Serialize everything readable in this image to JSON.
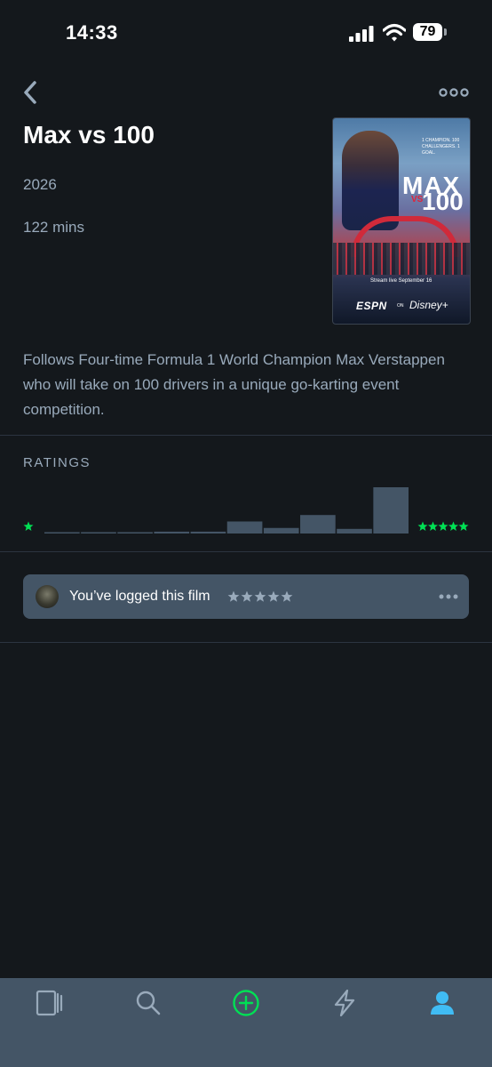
{
  "status_bar": {
    "time": "14:33",
    "battery": "79"
  },
  "film": {
    "title": "Max vs 100",
    "year": "2026",
    "runtime": "122 mins",
    "synopsis": "Follows Four-time Formula 1 World Champion Max Verstappen who will take on 100 drivers in a unique go-karting event competition."
  },
  "poster": {
    "tagline": "1 CHAMPION. 100 CHALLENGERS. 1 GOAL.",
    "title_top": "MAX",
    "title_vs": "VS",
    "title_bottom": "100",
    "stream_text": "Stream live September 16",
    "network": "ESPN",
    "on_text": "ON",
    "platform": "Disney+"
  },
  "ratings": {
    "label": "RATINGS",
    "histogram_relative": [
      0.02,
      0.02,
      0.02,
      0.04,
      0.04,
      0.26,
      0.12,
      0.4,
      0.1,
      1.0
    ]
  },
  "log": {
    "text": "You’ve logged this film",
    "stars": 5
  },
  "tabs": [
    {
      "name": "films-tab",
      "icon": "film-icon",
      "active": false
    },
    {
      "name": "search-tab",
      "icon": "search-icon",
      "active": false
    },
    {
      "name": "add-tab",
      "icon": "plus-circle-icon",
      "active": false
    },
    {
      "name": "activity-tab",
      "icon": "lightning-icon",
      "active": false
    },
    {
      "name": "profile-tab",
      "icon": "person-icon",
      "active": true
    }
  ],
  "colors": {
    "background": "#14181c",
    "text_muted": "#99aabb",
    "accent_green": "#00e054",
    "accent_blue": "#40bcf4",
    "bar": "#445566",
    "panel": "#445566"
  }
}
